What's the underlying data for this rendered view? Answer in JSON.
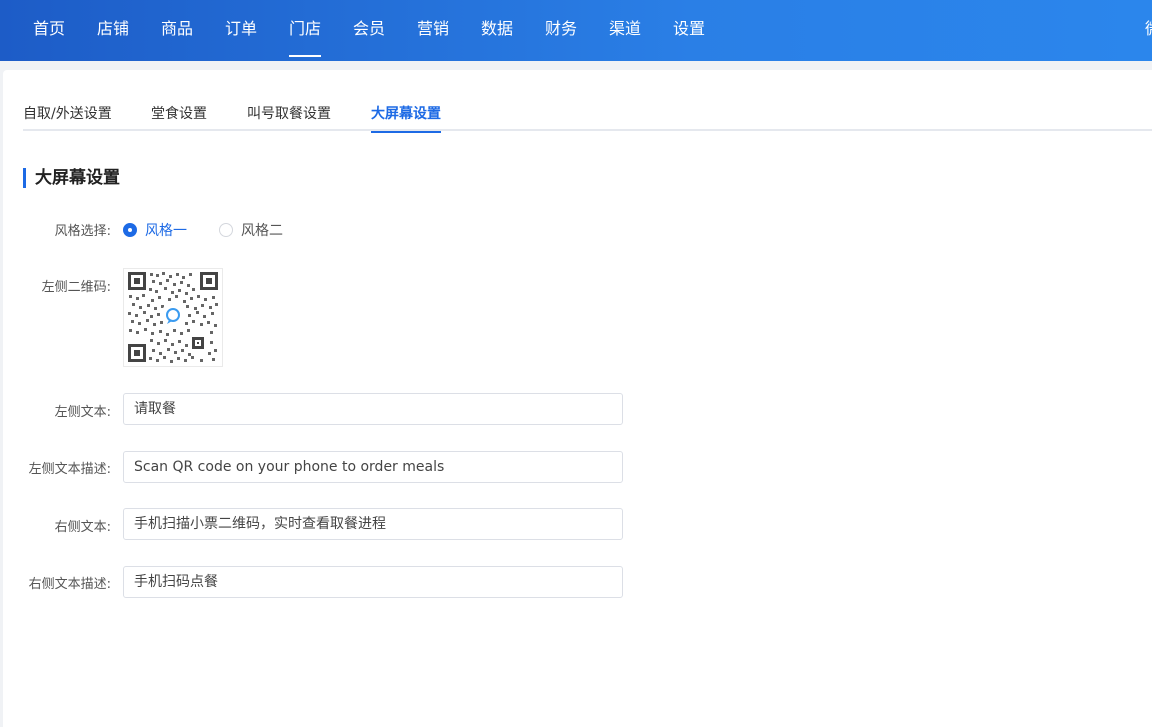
{
  "topnav": {
    "items": [
      {
        "label": "首页"
      },
      {
        "label": "店铺"
      },
      {
        "label": "商品"
      },
      {
        "label": "订单"
      },
      {
        "label": "门店",
        "active": true
      },
      {
        "label": "会员"
      },
      {
        "label": "营销"
      },
      {
        "label": "数据"
      },
      {
        "label": "财务"
      },
      {
        "label": "渠道"
      },
      {
        "label": "设置"
      }
    ],
    "edge_text": "微"
  },
  "tabs": [
    {
      "label": "自取/外送设置"
    },
    {
      "label": "堂食设置"
    },
    {
      "label": "叫号取餐设置"
    },
    {
      "label": "大屏幕设置",
      "active": true
    }
  ],
  "section": {
    "title": "大屏幕设置"
  },
  "form": {
    "style": {
      "label": "风格选择:",
      "options": [
        {
          "label": "风格一",
          "checked": true
        },
        {
          "label": "风格二",
          "checked": false
        }
      ]
    },
    "qr": {
      "label": "左侧二维码:"
    },
    "left_text": {
      "label": "左侧文本:",
      "value": "请取餐"
    },
    "left_desc": {
      "label": "左侧文本描述:",
      "value": "Scan QR code on your phone to order meals"
    },
    "right_text": {
      "label": "右侧文本:",
      "value": "手机扫描小票二维码，实时查看取餐进程"
    },
    "right_desc": {
      "label": "右侧文本描述:",
      "value": "手机扫码点餐"
    }
  },
  "colors": {
    "accent": "#1d6ae5",
    "nav_start": "#1d5cc7",
    "nav_end": "#2b86ec"
  }
}
